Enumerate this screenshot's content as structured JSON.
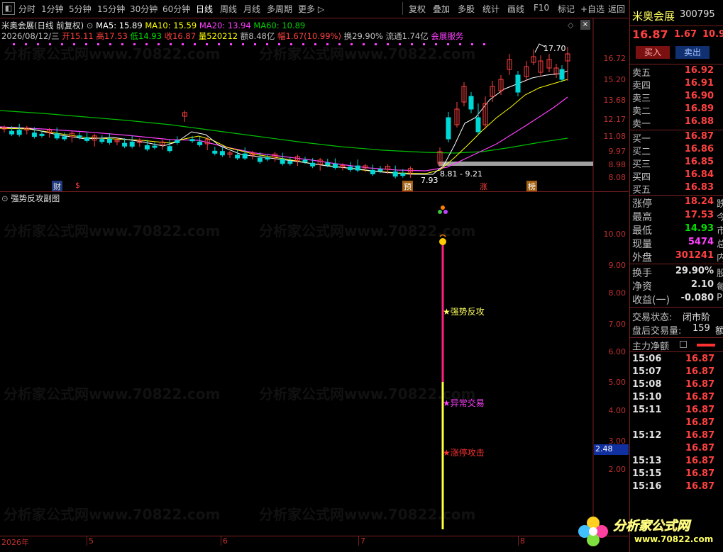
{
  "toolbar": {
    "periods": [
      "分时",
      "1分钟",
      "5分钟",
      "15分钟",
      "30分钟",
      "60分钟",
      "日线",
      "周线",
      "月线",
      "多周期",
      "更多 ▷"
    ],
    "active_period": "日线",
    "actions": [
      "复权",
      "叠加",
      "多股",
      "统计",
      "画线",
      "F10",
      "标记",
      "+自选",
      "返回"
    ]
  },
  "main_chart": {
    "title": "米奥会展(日线 前复权)",
    "ma5": "MA5: 15.89",
    "ma10": "MA10: 15.59",
    "ma20": "MA20: 13.94",
    "ma60": "MA60: 10.89",
    "info": {
      "date": "2026/08/12/三",
      "open": "开15.11",
      "high": "高17.53",
      "low": "低14.93",
      "close": "收16.87",
      "volume": "量520212",
      "amount": "额8.48亿",
      "change": "幅1.67(10.99%)",
      "turnover": "换29.90%",
      "float": "流通1.74亿",
      "sector": "会展服务"
    },
    "y_labels": [
      "16.72",
      "15.20",
      "13.68",
      "12.17",
      "11.08",
      "9.97",
      "8.98",
      "8.08"
    ],
    "high_mark": "17.70",
    "low_mark": "7.93",
    "range_mark": "8.81 - 9.21",
    "event_tags": [
      "财",
      "$",
      "预",
      "涨",
      "榜"
    ]
  },
  "sub_chart": {
    "title": "强势反攻副图",
    "y_labels": [
      "10.00",
      "9.00",
      "8.00",
      "7.00",
      "6.00",
      "5.00",
      "4.00",
      "3.00",
      "2.00"
    ],
    "current_value": "2.48",
    "signals": [
      "★强势反攻",
      "★异常交易",
      "★涨停攻击"
    ]
  },
  "bottom_bar": {
    "dates": [
      "2026年",
      "5",
      "6",
      "7",
      "8"
    ]
  },
  "quote_panel": {
    "name": "米奥会展",
    "code": "300795",
    "price": "16.87",
    "change": "1.67",
    "pct": "10.9",
    "buy_button": "买入",
    "sell_button": "卖出",
    "asks": [
      {
        "label": "卖五",
        "price": "16.92"
      },
      {
        "label": "卖四",
        "price": "16.91"
      },
      {
        "label": "卖三",
        "price": "16.90"
      },
      {
        "label": "卖二",
        "price": "16.89"
      },
      {
        "label": "卖一",
        "price": "16.88"
      }
    ],
    "bids": [
      {
        "label": "买一",
        "price": "16.87"
      },
      {
        "label": "买二",
        "price": "16.86"
      },
      {
        "label": "买三",
        "price": "16.85"
      },
      {
        "label": "买四",
        "price": "16.84"
      },
      {
        "label": "买五",
        "price": "16.83"
      }
    ],
    "stats": [
      {
        "label": "涨停",
        "value": "18.24",
        "color": "#ff4040",
        "suffix": "跌"
      },
      {
        "label": "最高",
        "value": "17.53",
        "color": "#ff4040",
        "suffix": "今"
      },
      {
        "label": "最低",
        "value": "14.93",
        "color": "#00e000",
        "suffix": "市"
      },
      {
        "label": "现量",
        "value": "5474",
        "color": "#ff40ff",
        "suffix": "总"
      },
      {
        "label": "外盘",
        "value": "301241",
        "color": "#ff4040",
        "suffix": "内"
      }
    ],
    "stats2": [
      {
        "label": "换手",
        "value": "29.90%",
        "suffix": "股"
      },
      {
        "label": "净资",
        "value": "2.10",
        "suffix": "每"
      },
      {
        "label": "收益(一)",
        "value": "-0.080",
        "suffix": "P"
      }
    ],
    "trade_status_label": "交易状态:",
    "trade_status_value": "闭市阶",
    "after_hours_label": "盘后交易量:",
    "after_hours_value": "159",
    "after_hours_suffix": "额",
    "capital_label": "主力净额",
    "ticks": [
      {
        "time": "15:06",
        "price": "16.87"
      },
      {
        "time": "15:07",
        "price": "16.87"
      },
      {
        "time": "15:08",
        "price": "16.87"
      },
      {
        "time": "15:10",
        "price": "16.87"
      },
      {
        "time": "15:11",
        "price": "16.87"
      },
      {
        "time": "",
        "price": "16.87"
      },
      {
        "time": "15:12",
        "price": "16.87"
      },
      {
        "time": "",
        "price": "16.87"
      },
      {
        "time": "15:13",
        "price": "16.87"
      },
      {
        "time": "15:15",
        "price": "16.87"
      },
      {
        "time": "15:16",
        "price": "16.87"
      }
    ]
  },
  "watermark": "分析家公式网www.70822.com",
  "logo_text": "分析家公式网",
  "logo_url": "www.70822.com",
  "colors": {
    "up": "#ff4040",
    "down": "#00d8d8",
    "ma5": "#ffffff",
    "ma10": "#ffff00",
    "ma20": "#ff40ff",
    "ma60": "#00d000",
    "border": "#7a1f1f"
  }
}
